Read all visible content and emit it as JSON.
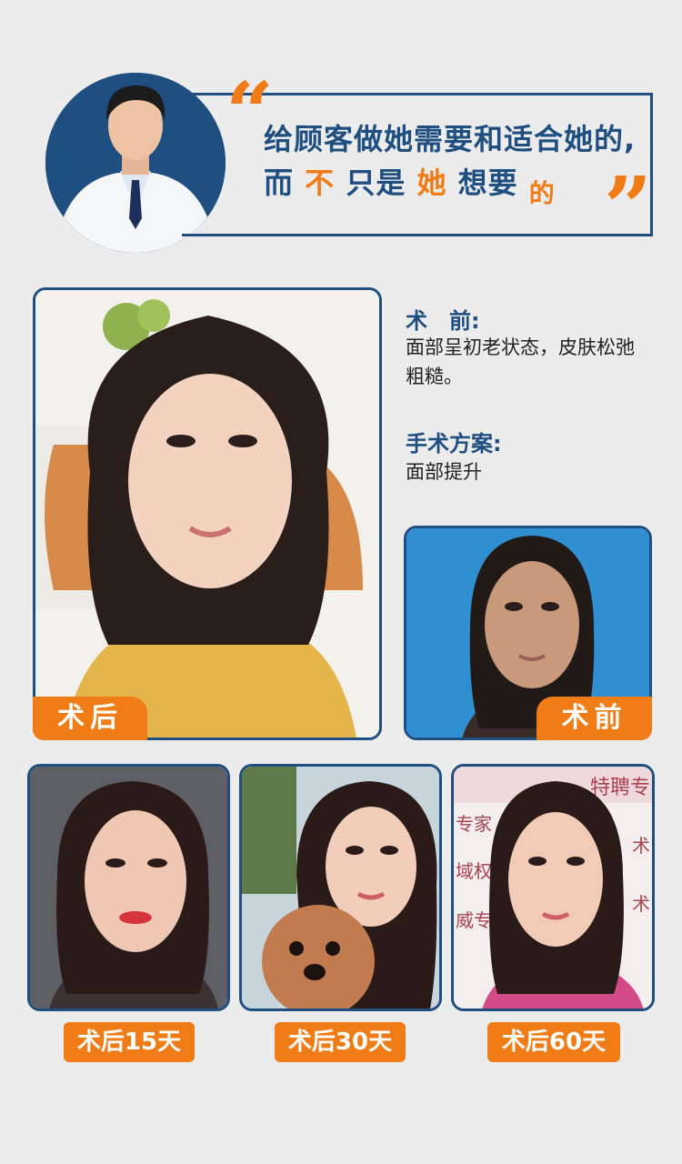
{
  "header": {
    "quote_open": "“",
    "quote_close": "”",
    "line1": "给顾客做她需要和适合她的,",
    "line2_parts": [
      "而",
      "不",
      "只是",
      "她",
      "想要",
      "的"
    ]
  },
  "photos": {
    "after_label": "术后",
    "before_label": "术前",
    "day15_label": "术后15天",
    "day30_label": "术后30天",
    "day60_label": "术后60天",
    "background_sign_text": [
      "特聘专",
      "专家",
      "域权",
      "威专",
      "术",
      "术"
    ]
  },
  "info": {
    "before_title": "术　前:",
    "before_desc": "面部呈初老状态，皮肤松弛粗糙。",
    "plan_title": "手术方案:",
    "plan_desc": "面部提升"
  },
  "colors": {
    "navy": "#1f4f80",
    "orange": "#ef7c16",
    "background": "#ececec"
  }
}
